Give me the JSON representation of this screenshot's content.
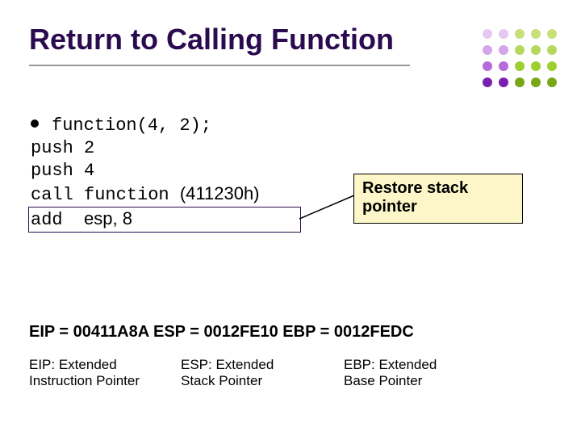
{
  "title": "Return to Calling Function",
  "code": {
    "first": "function(4, 2);",
    "line2": "push 2",
    "line3": "push 4",
    "line4_mono": "call function ",
    "line4_sans": "(411230h)",
    "line5_mono": "add  ",
    "line5_sans": "esp, 8"
  },
  "callout": {
    "line1": "Restore stack",
    "line2": "pointer"
  },
  "registers_line": "EIP = 00411A8A ESP = 0012FE10 EBP = 0012FEDC",
  "defs": {
    "eip": {
      "l1": "EIP: Extended",
      "l2": "Instruction Pointer"
    },
    "esp": {
      "l1": "ESP: Extended",
      "l2": "Stack Pointer"
    },
    "ebp": {
      "l1": "EBP: Extended",
      "l2": "Base Pointer"
    }
  }
}
